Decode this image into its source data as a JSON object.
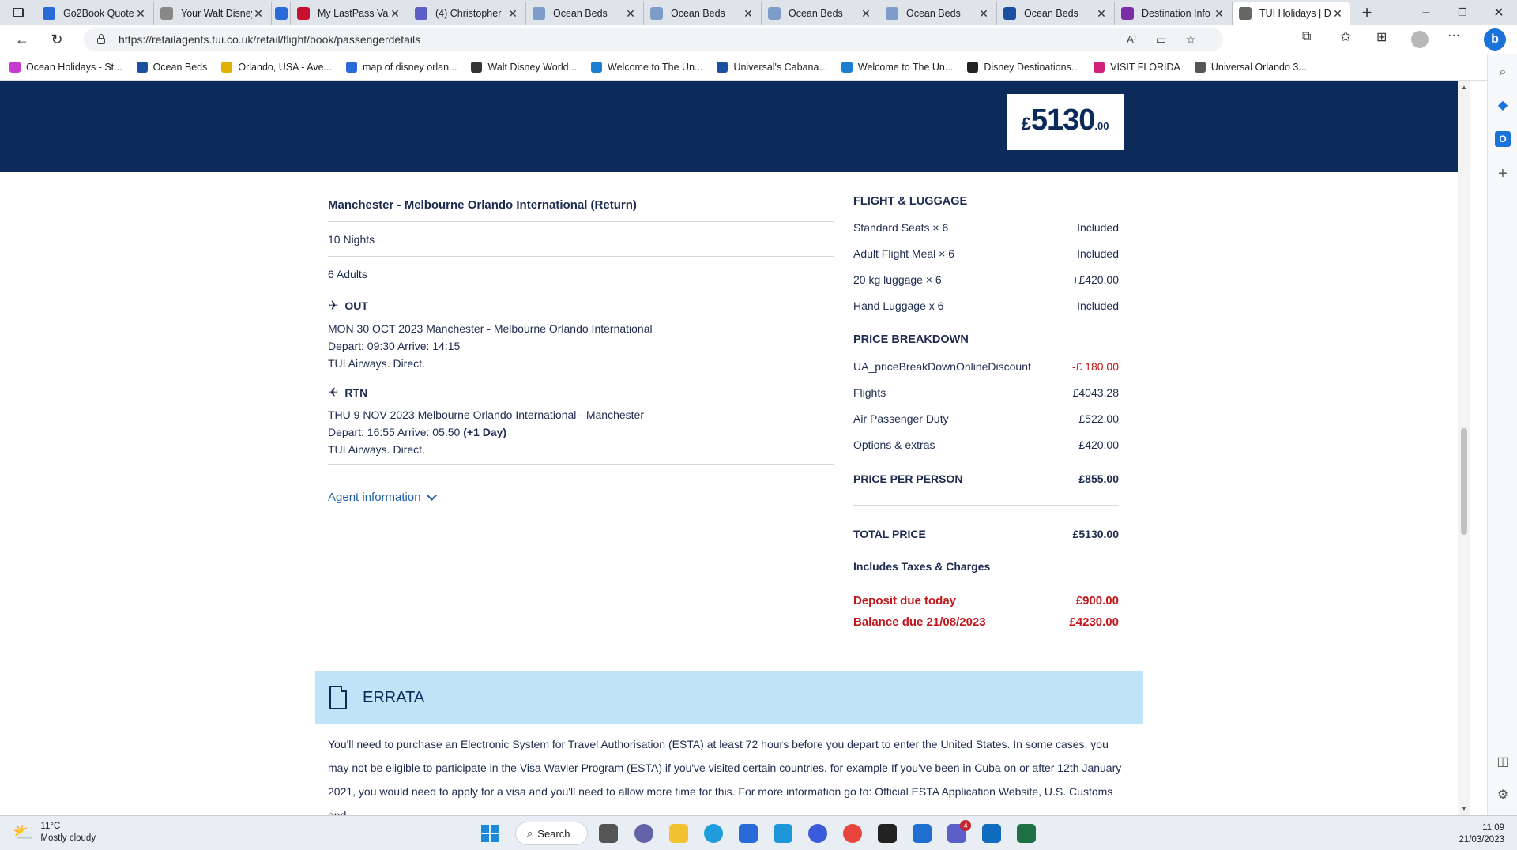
{
  "browser": {
    "tabs": [
      {
        "label": "Go2Book Quote",
        "color": "#2a6ad8"
      },
      {
        "label": "Your Walt Disney",
        "color": "#888888"
      },
      {
        "label": "",
        "color": "#2a6ad8"
      },
      {
        "label": "My LastPass Va",
        "color": "#c8102e"
      },
      {
        "label": "(4) Christopher",
        "color": "#5b5fc7"
      },
      {
        "label": "Ocean Beds",
        "color": "#7e9cc8"
      },
      {
        "label": "Ocean Beds",
        "color": "#7e9cc8"
      },
      {
        "label": "Ocean Beds",
        "color": "#7e9cc8"
      },
      {
        "label": "Ocean Beds",
        "color": "#7e9cc8"
      },
      {
        "label": "Ocean Beds",
        "color": "#1b4fa0"
      },
      {
        "label": "Destination Info",
        "color": "#7b2fa6"
      },
      {
        "label": "TUI Holidays | D",
        "color": "#666666"
      }
    ],
    "url": "https://retailagents.tui.co.uk/retail/flight/book/passengerdetails",
    "bookmarks": [
      {
        "label": "Ocean Holidays - St...",
        "color": "#c63ad0"
      },
      {
        "label": "Ocean Beds",
        "color": "#1b4fa0"
      },
      {
        "label": "Orlando, USA - Ave...",
        "color": "#e0b000"
      },
      {
        "label": "map of disney orlan...",
        "color": "#2a6ad8"
      },
      {
        "label": "Walt Disney World...",
        "color": "#333333"
      },
      {
        "label": "Welcome to The Un...",
        "color": "#1a7fd0"
      },
      {
        "label": "Universal's Cabana...",
        "color": "#1b4fa0"
      },
      {
        "label": "Welcome to The Un...",
        "color": "#1a7fd0"
      },
      {
        "label": "Disney Destinations...",
        "color": "#222222"
      },
      {
        "label": "VISIT FLORIDA",
        "color": "#d0207a"
      },
      {
        "label": "Universal Orlando 3...",
        "color": "#555555"
      }
    ]
  },
  "banner": {
    "currency": "£",
    "price_main": "5130",
    "price_dec": ".00"
  },
  "trip": {
    "route": "Manchester - Melbourne Orlando International (Return)",
    "nights": "10 Nights",
    "adults": "6  Adults",
    "out": {
      "label": "OUT",
      "line1": "MON 30 OCT 2023 Manchester  - Melbourne Orlando International",
      "line2": "Depart: 09:30 Arrive: 14:15",
      "line3": "TUI Airways. Direct."
    },
    "rtn": {
      "label": "RTN",
      "line1": "THU 9 NOV 2023 Melbourne Orlando International - Manchester",
      "line2a": "Depart: 16:55 Arrive: 05:50 ",
      "line2b": "(+1 Day)",
      "line3": "TUI Airways. Direct."
    },
    "agent_info": "Agent information"
  },
  "summary": {
    "flight_luggage_heading": "FLIGHT & LUGGAGE",
    "flight_luggage": [
      {
        "label": "Standard Seats × 6",
        "value": "Included"
      },
      {
        "label": "Adult Flight Meal × 6",
        "value": "Included"
      },
      {
        "label": "20 kg luggage × 6",
        "value": "+£420.00"
      },
      {
        "label": "Hand Luggage x 6",
        "value": "Included"
      }
    ],
    "price_breakdown_heading": "PRICE BREAKDOWN",
    "price_breakdown": [
      {
        "label": "UA_priceBreakDownOnlineDiscount",
        "value": "-£ 180.00"
      },
      {
        "label": "Flights",
        "value": "£4043.28"
      },
      {
        "label": "Air Passenger Duty",
        "value": "£522.00"
      },
      {
        "label": "Options & extras",
        "value": "£420.00"
      }
    ],
    "ppp_label": "PRICE PER PERSON",
    "ppp_value": "£855.00",
    "total_label": "TOTAL PRICE",
    "total_value": "£5130.00",
    "includes": "Includes Taxes & Charges",
    "deposit_label": "Deposit due today",
    "deposit_value": "£900.00",
    "balance_label": "Balance due 21/08/2023",
    "balance_value": "£4230.00"
  },
  "errata": {
    "title": "ERRATA",
    "text": "You'll need to purchase an Electronic System for Travel Authorisation (ESTA) at least 72 hours before you depart to enter the United States. In some cases, you may not be eligible to participate in the Visa Wavier Program (ESTA) if you've visited certain countries, for example If you've been in Cuba on or after 12th January 2021, you would need to apply for a visa and you'll need to allow more time for this. For more information go to: Official ESTA Application Website, U.S. Customs and"
  },
  "taskbar": {
    "weather_temp": "11°C",
    "weather_desc": "Mostly cloudy",
    "search_label": "Search",
    "time": "11:09",
    "date": "21/03/2023",
    "teams_badge": "4"
  }
}
